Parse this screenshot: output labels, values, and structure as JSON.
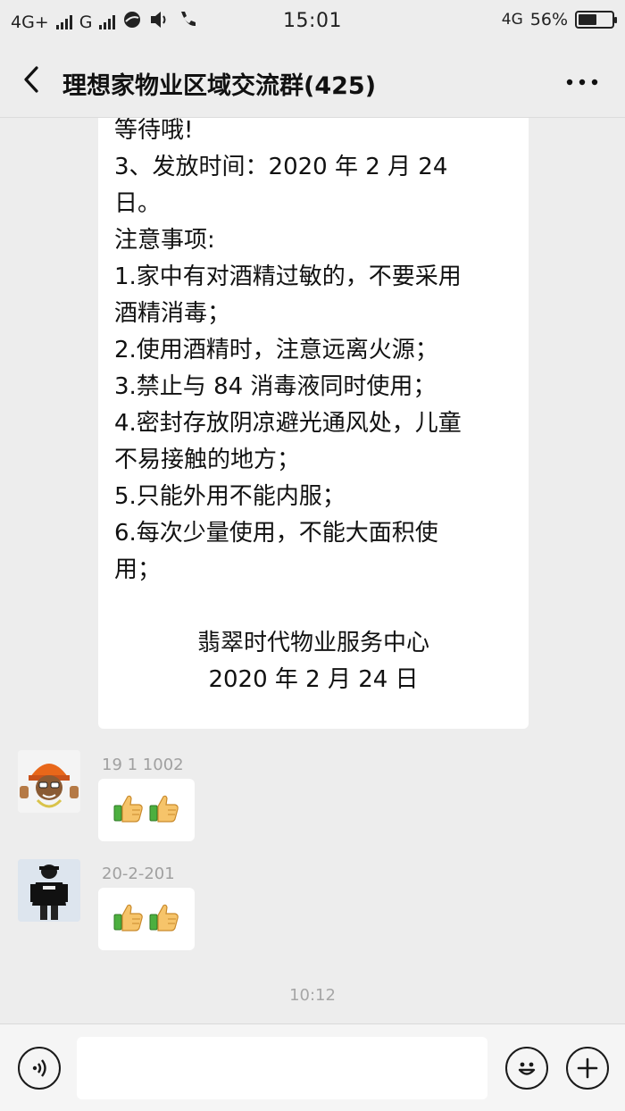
{
  "status_bar": {
    "net1": "4G+",
    "net2": "G",
    "time": "15:01",
    "net3": "4G",
    "battery": "56%",
    "battery_level": 0.56
  },
  "header": {
    "title": "理想家物业区域交流群(425)",
    "back_icon": "chevron-left-icon",
    "more_icon": "more-dots-icon"
  },
  "notice": {
    "lines": [
      "等待哦!",
      "3、发放时间：2020 年 2 月 24",
      "日。",
      "注意事项:",
      "1.家中有对酒精过敏的，不要采用",
      "酒精消毒；",
      "2.使用酒精时，注意远离火源；",
      "3.禁止与 84 消毒液同时使用；",
      "4.密封存放阴凉避光通风处，儿童",
      "不易接触的地方；",
      "5.只能外用不能内服；",
      "6.每次少量使用，不能大面积使",
      "用；"
    ],
    "signature": "翡翠时代物业服务中心",
    "date": "2020 年 2 月 24 日"
  },
  "messages": [
    {
      "nickname": "19  1    1002",
      "content_icon": "thumbs-up-icon",
      "count": 2
    },
    {
      "nickname": "20-2-201",
      "content_icon": "thumbs-up-icon",
      "count": 2
    }
  ],
  "timestamp": "10:12",
  "input_bar": {
    "voice_icon": "voice-icon",
    "emoji_icon": "smiley-icon",
    "add_icon": "plus-icon",
    "placeholder": ""
  }
}
